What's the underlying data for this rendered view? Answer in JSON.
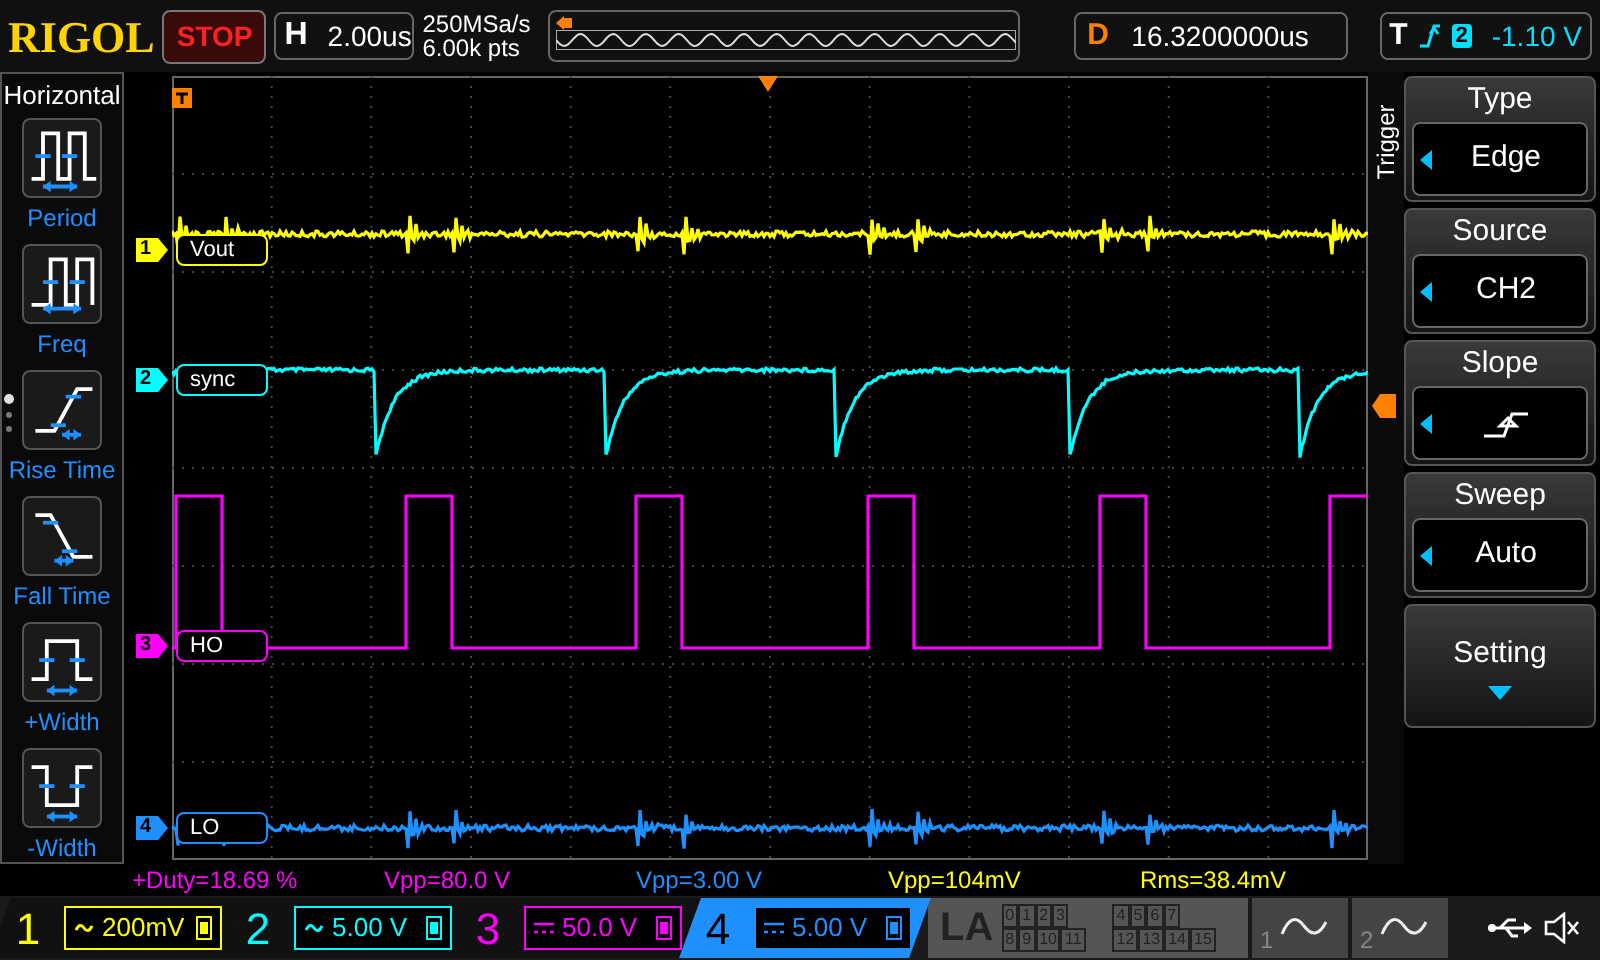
{
  "header": {
    "brand": "RIGOL",
    "run_state": "STOP",
    "horizontal": {
      "label": "H",
      "value": "2.00us"
    },
    "sample_rate": "250MSa/s",
    "memory_depth": "6.00k pts",
    "delay": {
      "label": "D",
      "value": "16.3200000us"
    },
    "trigger": {
      "label": "T",
      "source": "2",
      "level": "-1.10 V"
    }
  },
  "left_menu": {
    "title": "Horizontal",
    "items": [
      {
        "kind": "period",
        "label": "Period"
      },
      {
        "kind": "freq",
        "label": "Freq"
      },
      {
        "kind": "rise",
        "label": "Rise Time"
      },
      {
        "kind": "fall",
        "label": "Fall Time"
      },
      {
        "kind": "pwidth",
        "label": "+Width"
      },
      {
        "kind": "nwidth",
        "label": "-Width"
      }
    ],
    "pages": [
      {
        "selected": true
      },
      {
        "selected": false
      },
      {
        "selected": false
      }
    ]
  },
  "traces": [
    {
      "number": "1",
      "label": "Vout",
      "color": "#ffff00",
      "kind": "ripple"
    },
    {
      "number": "2",
      "label": "sync",
      "color": "#00ffff",
      "kind": "sync"
    },
    {
      "number": "3",
      "label": "HO",
      "color": "#ff00ff",
      "kind": "square"
    },
    {
      "number": "4",
      "label": "LO",
      "color": "#1e90ff",
      "kind": "ripple"
    }
  ],
  "measurements": [
    {
      "text": "+Duty=18.69 %",
      "color": "#ff00ff"
    },
    {
      "text": "Vpp=80.0 V",
      "color": "#ff00ff"
    },
    {
      "text": "Vpp=3.00 V",
      "color": "#1e90ff"
    },
    {
      "text": "Vpp=104mV",
      "color": "#ffff00"
    },
    {
      "text": "Rms=38.4mV",
      "color": "#ffff00"
    }
  ],
  "channels": [
    {
      "number": "1",
      "kind": "ac",
      "scale": "200mV",
      "color": "#ffff00",
      "selected": false
    },
    {
      "number": "2",
      "kind": "ac",
      "scale": "5.00 V",
      "color": "#00ffff",
      "selected": false
    },
    {
      "number": "3",
      "kind": "dc",
      "scale": "50.0 V",
      "color": "#ff00ff",
      "selected": false
    },
    {
      "number": "4",
      "kind": "dc",
      "scale": "5.00 V",
      "color": "#1e90ff",
      "selected": true
    }
  ],
  "logic": {
    "label": "LA",
    "groups": [
      [
        "0",
        "1",
        "2",
        "3"
      ],
      [
        "4",
        "5",
        "6",
        "7"
      ],
      [
        "8",
        "9",
        "10",
        "11"
      ],
      [
        "12",
        "13",
        "14",
        "15"
      ]
    ]
  },
  "math": [
    {
      "number": "1"
    },
    {
      "number": "2"
    }
  ],
  "trigger_menu": {
    "side_label": "Trigger",
    "items": [
      {
        "kind": "value",
        "title": "Type",
        "value": "Edge"
      },
      {
        "kind": "value",
        "title": "Source",
        "value": "CH2"
      },
      {
        "kind": "slope",
        "title": "Slope"
      },
      {
        "kind": "value",
        "title": "Sweep",
        "value": "Auto"
      },
      {
        "kind": "more",
        "title": "Setting"
      }
    ]
  }
}
